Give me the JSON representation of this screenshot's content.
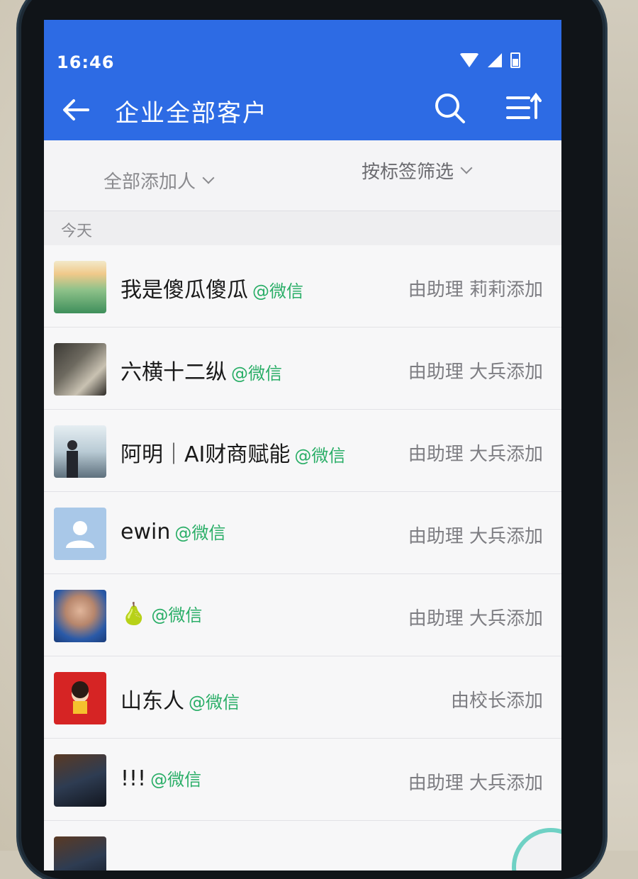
{
  "status_bar": {
    "time": "16:46"
  },
  "header": {
    "title": "企业全部客户"
  },
  "filters": {
    "adder_filter": "全部添加人",
    "tag_filter": "按标签筛选"
  },
  "section": {
    "label": "今天"
  },
  "contacts": [
    {
      "name": "我是傻瓜傻瓜",
      "tag": "@微信",
      "added_by": "由助理 莉莉添加",
      "avatar": "landscape-avatar"
    },
    {
      "name": "六横十二纵",
      "tag": "@微信",
      "added_by": "由助理 大兵添加",
      "avatar": "photo-avatar"
    },
    {
      "name": "阿明｜AI财商赋能",
      "tag": "@微信",
      "added_by": "由助理 大兵添加",
      "avatar": "portrait-avatar"
    },
    {
      "name": "ewin",
      "tag": "@微信",
      "added_by": "由助理 大兵添加",
      "avatar": "default-user-avatar"
    },
    {
      "name": "🍐",
      "tag": "@微信",
      "added_by": "由助理 大兵添加",
      "avatar": "face-avatar"
    },
    {
      "name": "山东人",
      "tag": "@微信",
      "added_by": "由校长添加",
      "avatar": "red-festive-avatar"
    },
    {
      "name": "!!!",
      "tag": "@微信",
      "added_by": "由助理 大兵添加",
      "avatar": "dark-photo-avatar"
    }
  ],
  "colors": {
    "header_blue": "#2d6be4",
    "wechat_tag_green": "#2aae67"
  }
}
